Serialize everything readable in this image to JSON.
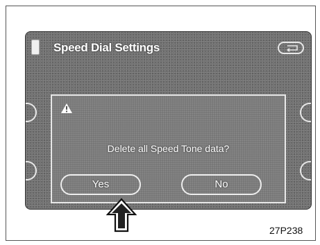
{
  "screen": {
    "title": "Speed Dial Settings",
    "back_button": {
      "icon": "back-arrow-icon"
    }
  },
  "dialog": {
    "icon": "warning-icon",
    "message": "Delete all Speed Tone data?",
    "yes_label": "Yes",
    "no_label": "No"
  },
  "figure": {
    "code": "27P238",
    "pointer_icon": "up-arrow-icon"
  }
}
